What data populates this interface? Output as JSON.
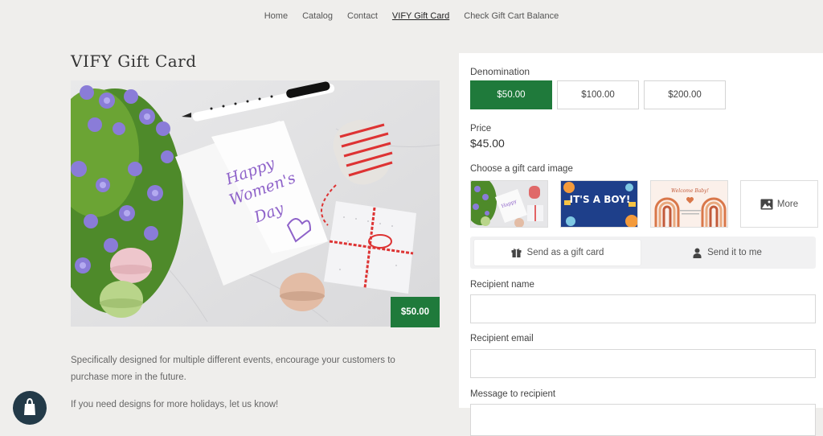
{
  "nav": {
    "items": [
      {
        "label": "Home"
      },
      {
        "label": "Catalog"
      },
      {
        "label": "Contact"
      },
      {
        "label": "VIFY Gift Card"
      },
      {
        "label": "Check Gift Cart Balance"
      }
    ],
    "active_index": 3
  },
  "product": {
    "title": "VIFY Gift Card",
    "hero_card_text": "Happy Women's Day",
    "price_badge": "$50.00",
    "description": [
      "Specifically designed for multiple different events, encourage your customers to purchase more in the future.",
      "If you need designs for more holidays, let us know!"
    ]
  },
  "form": {
    "denomination_label": "Denomination",
    "denominations": [
      "$50.00",
      "$100.00",
      "$200.00"
    ],
    "selected_denomination": "$50.00",
    "price_label": "Price",
    "price_value": "$45.00",
    "image_label": "Choose a gift card image",
    "thumbnails": [
      {
        "name": "womens-day",
        "text": ""
      },
      {
        "name": "its-a-boy",
        "text": "IT'S A BOY!"
      },
      {
        "name": "welcome-baby",
        "text": "Welcome Baby!"
      }
    ],
    "more_label": "More",
    "send_gift_label": "Send as a gift card",
    "send_me_label": "Send it to me",
    "recipient_name_label": "Recipient name",
    "recipient_name_value": "",
    "recipient_email_label": "Recipient email",
    "recipient_email_value": "",
    "message_label": "Message to recipient"
  },
  "colors": {
    "accent_green": "#1f7a3b",
    "page_bg": "#efeeec",
    "chat_button": "#233a48"
  }
}
